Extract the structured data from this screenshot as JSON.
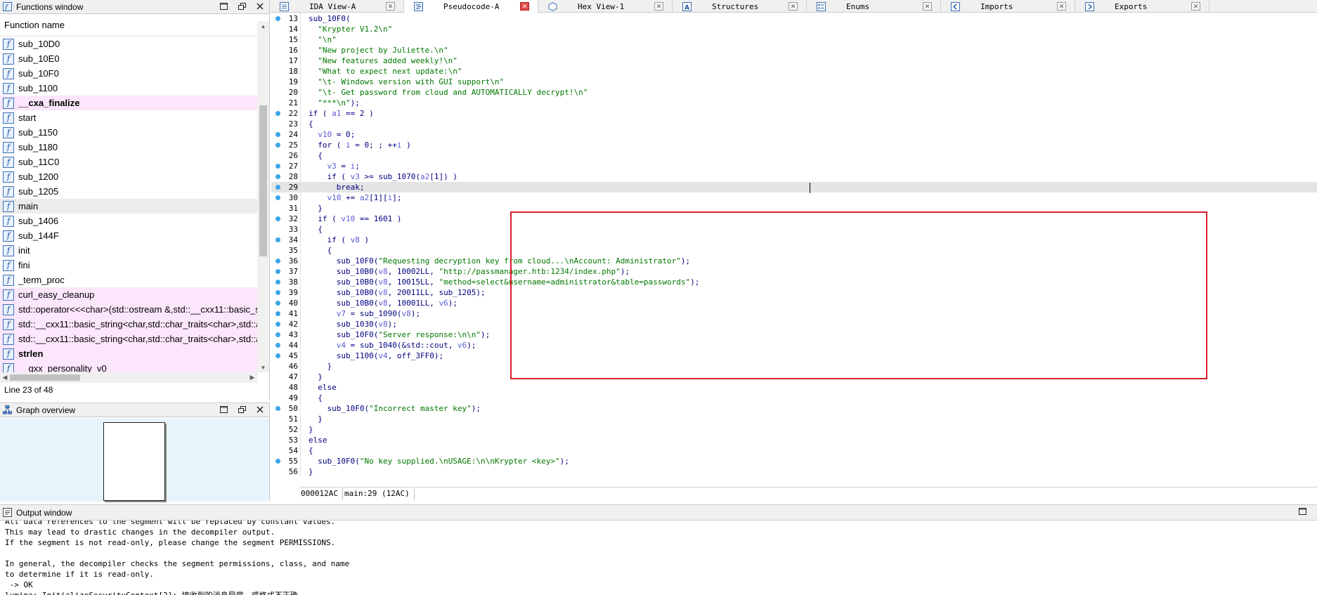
{
  "functions_window": {
    "title": "Functions window",
    "column_header": "Function name",
    "functions": [
      {
        "name": "sub_10D0",
        "kind": "normal"
      },
      {
        "name": "sub_10E0",
        "kind": "normal"
      },
      {
        "name": "sub_10F0",
        "kind": "normal"
      },
      {
        "name": "sub_1100",
        "kind": "normal"
      },
      {
        "name": "__cxa_finalize",
        "kind": "lib-bold"
      },
      {
        "name": "start",
        "kind": "normal"
      },
      {
        "name": "sub_1150",
        "kind": "normal"
      },
      {
        "name": "sub_1180",
        "kind": "normal"
      },
      {
        "name": "sub_11C0",
        "kind": "normal"
      },
      {
        "name": "sub_1200",
        "kind": "normal"
      },
      {
        "name": "sub_1205",
        "kind": "normal"
      },
      {
        "name": "main",
        "kind": "selected"
      },
      {
        "name": "sub_1406",
        "kind": "normal"
      },
      {
        "name": "sub_144F",
        "kind": "normal"
      },
      {
        "name": "init",
        "kind": "normal"
      },
      {
        "name": "fini",
        "kind": "normal"
      },
      {
        "name": "_term_proc",
        "kind": "normal"
      },
      {
        "name": "curl_easy_cleanup",
        "kind": "lib"
      },
      {
        "name": "std::operator<<<char>(std::ostream &,std::__cxx11::basic_s",
        "kind": "lib"
      },
      {
        "name": "std::__cxx11::basic_string<char,std::char_traits<char>,std::al",
        "kind": "lib"
      },
      {
        "name": "std::__cxx11::basic_string<char,std::char_traits<char>,std::al",
        "kind": "lib"
      },
      {
        "name": "strlen",
        "kind": "lib-bold"
      },
      {
        "name": "__gxx_personality_v0",
        "kind": "lib"
      }
    ],
    "status": "Line 23 of 48"
  },
  "graph_overview": {
    "title": "Graph overview"
  },
  "tabs": [
    {
      "label": "IDA View-A",
      "icon": "ida-view-icon",
      "active": false
    },
    {
      "label": "Pseudocode-A",
      "icon": "pseudocode-icon",
      "active": true
    },
    {
      "label": "Hex View-1",
      "icon": "hex-view-icon",
      "active": false
    },
    {
      "label": "Structures",
      "icon": "structures-icon",
      "active": false
    },
    {
      "label": "Enums",
      "icon": "enums-icon",
      "active": false
    },
    {
      "label": "Imports",
      "icon": "imports-icon",
      "active": false
    },
    {
      "label": "Exports",
      "icon": "exports-icon",
      "active": false
    }
  ],
  "pseudocode": {
    "current_line": 29,
    "lines": [
      {
        "n": "13",
        "bp": true,
        "tokens": [
          [
            "k",
            "sub_10F0("
          ]
        ]
      },
      {
        "n": "14",
        "bp": false,
        "tokens": [
          [
            "s",
            "  \"Krypter V1.2\\n\""
          ]
        ]
      },
      {
        "n": "15",
        "bp": false,
        "tokens": [
          [
            "s",
            "  \"\\n\""
          ]
        ]
      },
      {
        "n": "16",
        "bp": false,
        "tokens": [
          [
            "s",
            "  \"New project by Juliette.\\n\""
          ]
        ]
      },
      {
        "n": "17",
        "bp": false,
        "tokens": [
          [
            "s",
            "  \"New features added weekly!\\n\""
          ]
        ]
      },
      {
        "n": "18",
        "bp": false,
        "tokens": [
          [
            "s",
            "  \"What to expect next update:\\n\""
          ]
        ]
      },
      {
        "n": "19",
        "bp": false,
        "tokens": [
          [
            "s",
            "  \"\\t- Windows version with GUI support\\n\""
          ]
        ]
      },
      {
        "n": "20",
        "bp": false,
        "tokens": [
          [
            "s",
            "  \"\\t- Get password from cloud and AUTOMATICALLY decrypt!\\n\""
          ]
        ]
      },
      {
        "n": "21",
        "bp": false,
        "tokens": [
          [
            "s",
            "  \"***\\n\""
          ],
          [
            "k",
            ");"
          ]
        ]
      },
      {
        "n": "22",
        "bp": true,
        "tokens": [
          [
            "k",
            "if ( "
          ],
          [
            "v",
            "a1"
          ],
          [
            "k",
            " == 2 )"
          ]
        ]
      },
      {
        "n": "23",
        "bp": false,
        "tokens": [
          [
            "k",
            "{"
          ]
        ]
      },
      {
        "n": "24",
        "bp": true,
        "tokens": [
          [
            "k",
            "  "
          ],
          [
            "v",
            "v10"
          ],
          [
            "k",
            " = 0;"
          ]
        ]
      },
      {
        "n": "25",
        "bp": true,
        "tokens": [
          [
            "k",
            "  for ( "
          ],
          [
            "v",
            "i"
          ],
          [
            "k",
            " = 0; ; ++"
          ],
          [
            "v",
            "i"
          ],
          [
            "k",
            " )"
          ]
        ]
      },
      {
        "n": "26",
        "bp": false,
        "tokens": [
          [
            "k",
            "  {"
          ]
        ]
      },
      {
        "n": "27",
        "bp": true,
        "tokens": [
          [
            "k",
            "    "
          ],
          [
            "v",
            "v3"
          ],
          [
            "k",
            " = "
          ],
          [
            "v",
            "i"
          ],
          [
            "k",
            ";"
          ]
        ]
      },
      {
        "n": "28",
        "bp": true,
        "tokens": [
          [
            "k",
            "    if ( "
          ],
          [
            "v",
            "v3"
          ],
          [
            "k",
            " >= sub_1070("
          ],
          [
            "v",
            "a2"
          ],
          [
            "k",
            "[1]) )"
          ]
        ]
      },
      {
        "n": "29",
        "bp": true,
        "tokens": [
          [
            "k",
            "      break;"
          ]
        ]
      },
      {
        "n": "30",
        "bp": true,
        "tokens": [
          [
            "k",
            "    "
          ],
          [
            "v",
            "v10"
          ],
          [
            "k",
            " += "
          ],
          [
            "v",
            "a2"
          ],
          [
            "k",
            "[1]["
          ],
          [
            "v",
            "i"
          ],
          [
            "k",
            "];"
          ]
        ]
      },
      {
        "n": "31",
        "bp": false,
        "tokens": [
          [
            "k",
            "  }"
          ]
        ]
      },
      {
        "n": "32",
        "bp": true,
        "tokens": [
          [
            "k",
            "  if ( "
          ],
          [
            "v",
            "v10"
          ],
          [
            "k",
            " == 1601 )"
          ]
        ]
      },
      {
        "n": "33",
        "bp": false,
        "tokens": [
          [
            "k",
            "  {"
          ]
        ]
      },
      {
        "n": "34",
        "bp": true,
        "tokens": [
          [
            "k",
            "    if ( "
          ],
          [
            "v",
            "v8"
          ],
          [
            "k",
            " )"
          ]
        ]
      },
      {
        "n": "35",
        "bp": false,
        "tokens": [
          [
            "k",
            "    {"
          ]
        ]
      },
      {
        "n": "36",
        "bp": true,
        "tokens": [
          [
            "k",
            "      sub_10F0("
          ],
          [
            "s",
            "\"Requesting decryption key from cloud...\\nAccount: Administrator\""
          ],
          [
            "k",
            ");"
          ]
        ]
      },
      {
        "n": "37",
        "bp": true,
        "tokens": [
          [
            "k",
            "      sub_10B0("
          ],
          [
            "v",
            "v8"
          ],
          [
            "k",
            ", 10002LL, "
          ],
          [
            "s",
            "\"http://passmanager.htb:1234/index.php\""
          ],
          [
            "k",
            ");"
          ]
        ]
      },
      {
        "n": "38",
        "bp": true,
        "tokens": [
          [
            "k",
            "      sub_10B0("
          ],
          [
            "v",
            "v8"
          ],
          [
            "k",
            ", 10015LL, "
          ],
          [
            "s",
            "\"method=select&username=administrator&table=passwords\""
          ],
          [
            "k",
            ");"
          ]
        ]
      },
      {
        "n": "39",
        "bp": true,
        "tokens": [
          [
            "k",
            "      sub_10B0("
          ],
          [
            "v",
            "v8"
          ],
          [
            "k",
            ", 20011LL, sub_1205);"
          ]
        ]
      },
      {
        "n": "40",
        "bp": true,
        "tokens": [
          [
            "k",
            "      sub_10B0("
          ],
          [
            "v",
            "v8"
          ],
          [
            "k",
            ", 10001LL, "
          ],
          [
            "v",
            "v6"
          ],
          [
            "k",
            ");"
          ]
        ]
      },
      {
        "n": "41",
        "bp": true,
        "tokens": [
          [
            "k",
            "      "
          ],
          [
            "v",
            "v7"
          ],
          [
            "k",
            " = sub_1090("
          ],
          [
            "v",
            "v8"
          ],
          [
            "k",
            ");"
          ]
        ]
      },
      {
        "n": "42",
        "bp": true,
        "tokens": [
          [
            "k",
            "      sub_1030("
          ],
          [
            "v",
            "v8"
          ],
          [
            "k",
            ");"
          ]
        ]
      },
      {
        "n": "43",
        "bp": true,
        "tokens": [
          [
            "k",
            "      sub_10F0("
          ],
          [
            "s",
            "\"Server response:\\n\\n\""
          ],
          [
            "k",
            ");"
          ]
        ]
      },
      {
        "n": "44",
        "bp": true,
        "tokens": [
          [
            "k",
            "      "
          ],
          [
            "v",
            "v4"
          ],
          [
            "k",
            " = sub_1040(&std::cout, "
          ],
          [
            "v",
            "v6"
          ],
          [
            "k",
            ");"
          ]
        ]
      },
      {
        "n": "45",
        "bp": true,
        "tokens": [
          [
            "k",
            "      sub_1100("
          ],
          [
            "v",
            "v4"
          ],
          [
            "k",
            ", off_3FF0);"
          ]
        ]
      },
      {
        "n": "46",
        "bp": false,
        "tokens": [
          [
            "k",
            "    }"
          ]
        ]
      },
      {
        "n": "47",
        "bp": false,
        "tokens": [
          [
            "k",
            "  }"
          ]
        ]
      },
      {
        "n": "48",
        "bp": false,
        "tokens": [
          [
            "k",
            "  else"
          ]
        ]
      },
      {
        "n": "49",
        "bp": false,
        "tokens": [
          [
            "k",
            "  {"
          ]
        ]
      },
      {
        "n": "50",
        "bp": true,
        "tokens": [
          [
            "k",
            "    sub_10F0("
          ],
          [
            "s",
            "\"Incorrect master key\""
          ],
          [
            "k",
            ");"
          ]
        ]
      },
      {
        "n": "51",
        "bp": false,
        "tokens": [
          [
            "k",
            "  }"
          ]
        ]
      },
      {
        "n": "52",
        "bp": false,
        "tokens": [
          [
            "k",
            "}"
          ]
        ]
      },
      {
        "n": "53",
        "bp": false,
        "tokens": [
          [
            "k",
            "else"
          ]
        ]
      },
      {
        "n": "54",
        "bp": false,
        "tokens": [
          [
            "k",
            "{"
          ]
        ]
      },
      {
        "n": "55",
        "bp": true,
        "tokens": [
          [
            "k",
            "  sub_10F0("
          ],
          [
            "s",
            "\"No key supplied.\\nUSAGE:\\n\\nKrypter <key>\""
          ],
          [
            "k",
            ");"
          ]
        ]
      },
      {
        "n": "56",
        "bp": false,
        "tokens": [
          [
            "k",
            "}"
          ]
        ]
      }
    ],
    "status_address": "000012AC",
    "status_location": "main:29 (12AC)"
  },
  "output_window": {
    "title": "Output window",
    "lines": [
      "All data references to the segment will be replaced by constant values.",
      "This may lead to drastic changes in the decompiler output.",
      "If the segment is not read-only, please change the segment PERMISSIONS.",
      "",
      "In general, the decompiler checks the segment permissions, class, and name",
      "to determine if it is read-only.",
      " -> OK",
      "lumina: InitializeSecurityContext[2]: 接收到的消息异常，或格式不正确。"
    ]
  },
  "colors": {
    "code_default": "#000080",
    "code_string": "#007800",
    "code_variable": "#5a5ad8",
    "breakpoint_dot": "#39a7e8",
    "lib_function_bg": "#fbe6fb",
    "annotation_box": "#d81e2c",
    "active_tab_close": "#e04848"
  }
}
